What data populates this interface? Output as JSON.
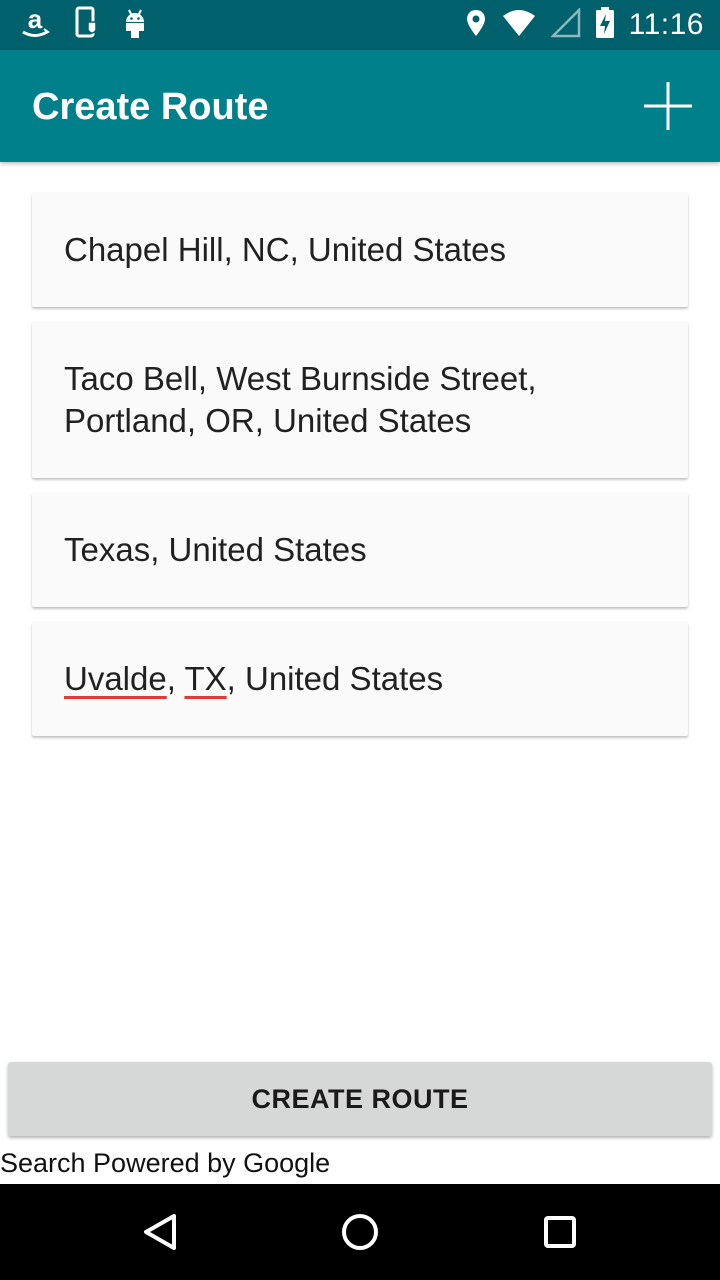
{
  "status_bar": {
    "time": "11:16",
    "icons": [
      "amazon-icon",
      "phone-shield-icon",
      "android-icon",
      "location-icon",
      "wifi-icon",
      "signal-icon",
      "battery-charging-icon"
    ]
  },
  "app_bar": {
    "title": "Create Route",
    "action_icon": "add-icon"
  },
  "locations": [
    {
      "text": "Chapel Hill, NC, United States"
    },
    {
      "line1": "Taco Bell, West Burnside Street,",
      "line2": "Portland, OR, United States"
    },
    {
      "text": "Texas, United States"
    },
    {
      "word1": "Uvalde",
      "sep1": ", ",
      "word2": "TX",
      "rest": ", United States"
    }
  ],
  "create_button": {
    "label": "CREATE ROUTE"
  },
  "footer": {
    "powered_by": "Search Powered by Google"
  },
  "nav_bar": {
    "icons": [
      "back-icon",
      "home-icon",
      "recents-icon"
    ]
  },
  "colors": {
    "status_bar": "#00606b",
    "app_bar": "#00808a",
    "card": "#fafafa",
    "button": "#d6d7d7",
    "spellcheck": "#e53935"
  }
}
